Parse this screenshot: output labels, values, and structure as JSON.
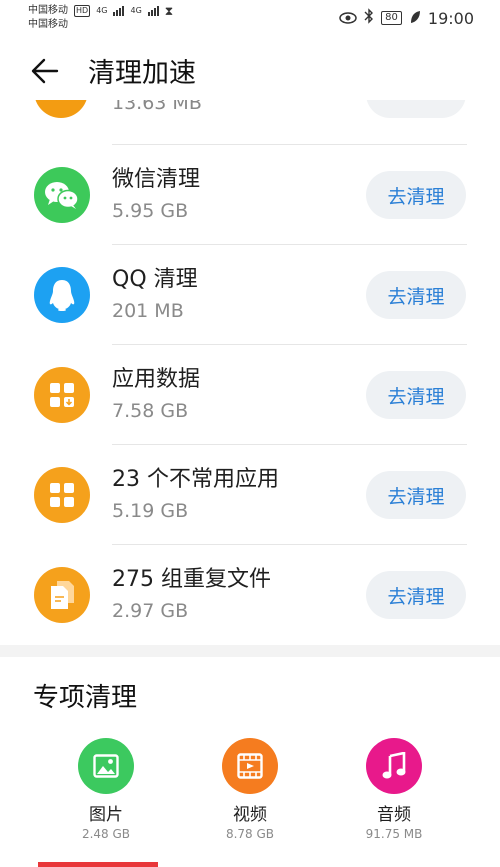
{
  "status": {
    "carrier1": "中国移动",
    "carrier1_badge": "HD",
    "carrier2": "中国移动",
    "net1": "4G",
    "net2": "4G",
    "battery": "80",
    "time": "19:00"
  },
  "header": {
    "title": "清理加速"
  },
  "partial_item": {
    "size": "13.63 MB"
  },
  "items": [
    {
      "name": "微信清理",
      "size": "5.95 GB",
      "button": "去清理",
      "icon": "wechat-icon",
      "color": "#3dc95a"
    },
    {
      "name": "QQ 清理",
      "size": "201 MB",
      "button": "去清理",
      "icon": "qq-penguin-icon",
      "color": "#1da1f2"
    },
    {
      "name": "应用数据",
      "size": "7.58 GB",
      "button": "去清理",
      "icon": "app-data-icon",
      "color": "#f5a11c"
    },
    {
      "name": "23 个不常用应用",
      "size": "5.19 GB",
      "button": "去清理",
      "icon": "apps-grid-icon",
      "color": "#f5a11c"
    },
    {
      "name": "275 组重复文件",
      "size": "2.97 GB",
      "button": "去清理",
      "icon": "duplicate-files-icon",
      "color": "#f5a11c"
    }
  ],
  "special_section": {
    "title": "专项清理",
    "items": [
      {
        "label": "图片",
        "size": "2.48 GB",
        "icon": "image-icon",
        "color": "#3cc95f"
      },
      {
        "label": "视频",
        "size": "8.78 GB",
        "icon": "video-icon",
        "color": "#f57c1f"
      },
      {
        "label": "音频",
        "size": "91.75 MB",
        "icon": "music-note-icon",
        "color": "#e8198b"
      }
    ]
  }
}
